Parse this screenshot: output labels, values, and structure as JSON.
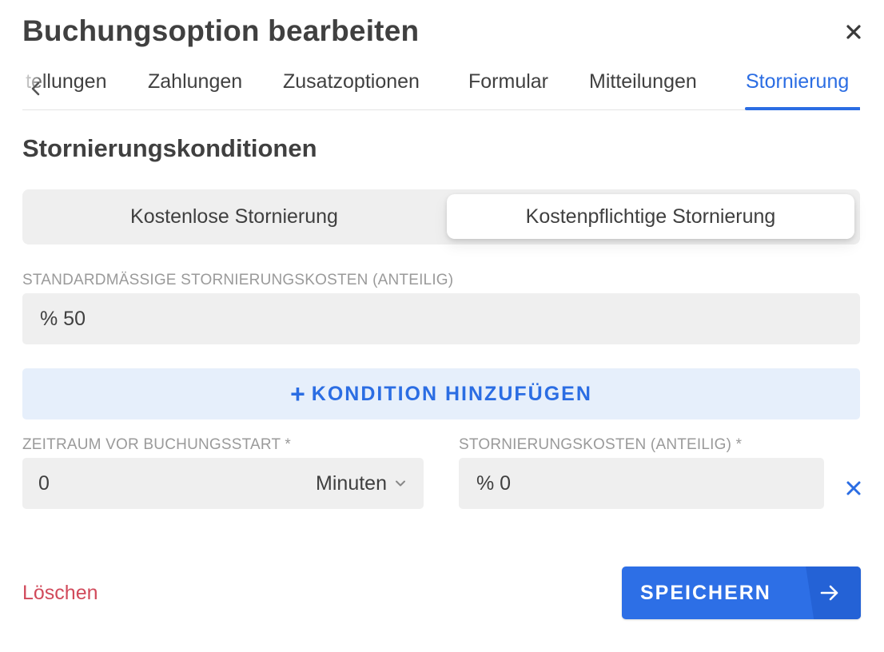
{
  "dialog": {
    "title": "Buchungsoption bearbeiten"
  },
  "tabs": [
    {
      "label": "tellungen"
    },
    {
      "label": "Zahlungen"
    },
    {
      "label": "Zusatzoptionen"
    },
    {
      "label": "Formular"
    },
    {
      "label": "Mitteilungen"
    },
    {
      "label": "Stornierung",
      "active": true
    }
  ],
  "section": {
    "title": "Stornierungskonditionen"
  },
  "segmented": {
    "free_label": "Kostenlose Stornierung",
    "paid_label": "Kostenpflichtige Stornierung",
    "selected": "paid"
  },
  "default_cost": {
    "label": "STANDARDMÄSSIGE STORNIERUNGSKOSTEN (ANTEILIG)",
    "value": "% 50"
  },
  "add_condition": {
    "icon": "+",
    "label": "KONDITION HINZUFÜGEN"
  },
  "condition": {
    "period_label": "ZEITRAUM VOR BUCHUNGSSTART *",
    "period_value": "0",
    "period_unit": "Minuten",
    "cost_label": "STORNIERUNGSKOSTEN (ANTEILIG) *",
    "cost_value": "% 0"
  },
  "footer": {
    "delete_label": "Löschen",
    "save_label": "SPEICHERN"
  },
  "colors": {
    "accent": "#2b6de3",
    "danger": "#d14a5b",
    "field_bg": "#efefef",
    "add_bg": "#e6effb"
  },
  "icons": {
    "close": "close-icon",
    "tab_prev": "chevron-left-icon",
    "unit_dropdown": "chevron-down-icon",
    "remove": "close-icon",
    "save": "arrow-right-icon"
  }
}
